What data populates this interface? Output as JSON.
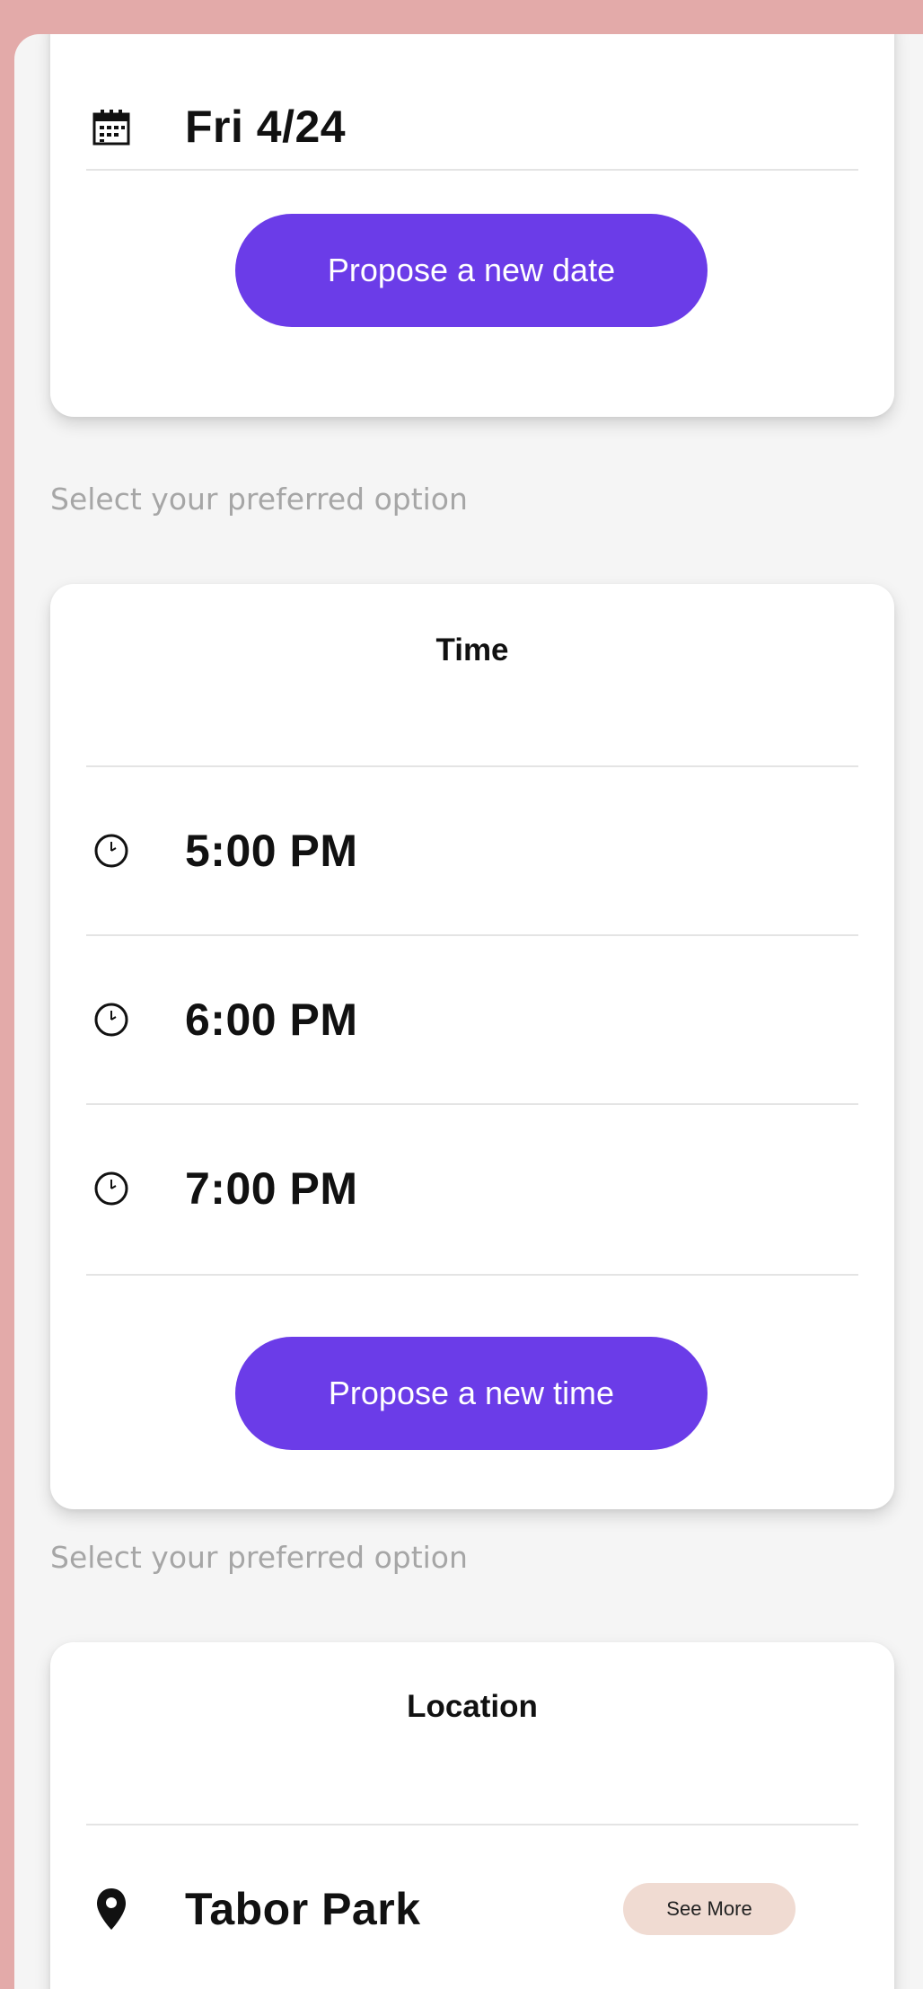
{
  "colors": {
    "background": "#e3aaa9",
    "screen": "#f5f5f5",
    "accent": "#6b3ce8",
    "see_more_bg": "#f0dbd2",
    "hint_text": "#a6a6a6"
  },
  "date_card": {
    "icon": "calendar-icon",
    "date": "Fri 4/24",
    "propose_button": "Propose a new date"
  },
  "time_hint": "Select your preferred option",
  "time_card": {
    "title": "Time",
    "icon": "clock-icon",
    "options": [
      "5:00 PM",
      "6:00 PM",
      "7:00 PM"
    ],
    "propose_button": "Propose a new time"
  },
  "location_hint": "Select your preferred option",
  "location_card": {
    "title": "Location",
    "icon": "map-pin-icon",
    "options": [
      {
        "name": "Tabor Park",
        "see_more": "See More"
      }
    ]
  }
}
